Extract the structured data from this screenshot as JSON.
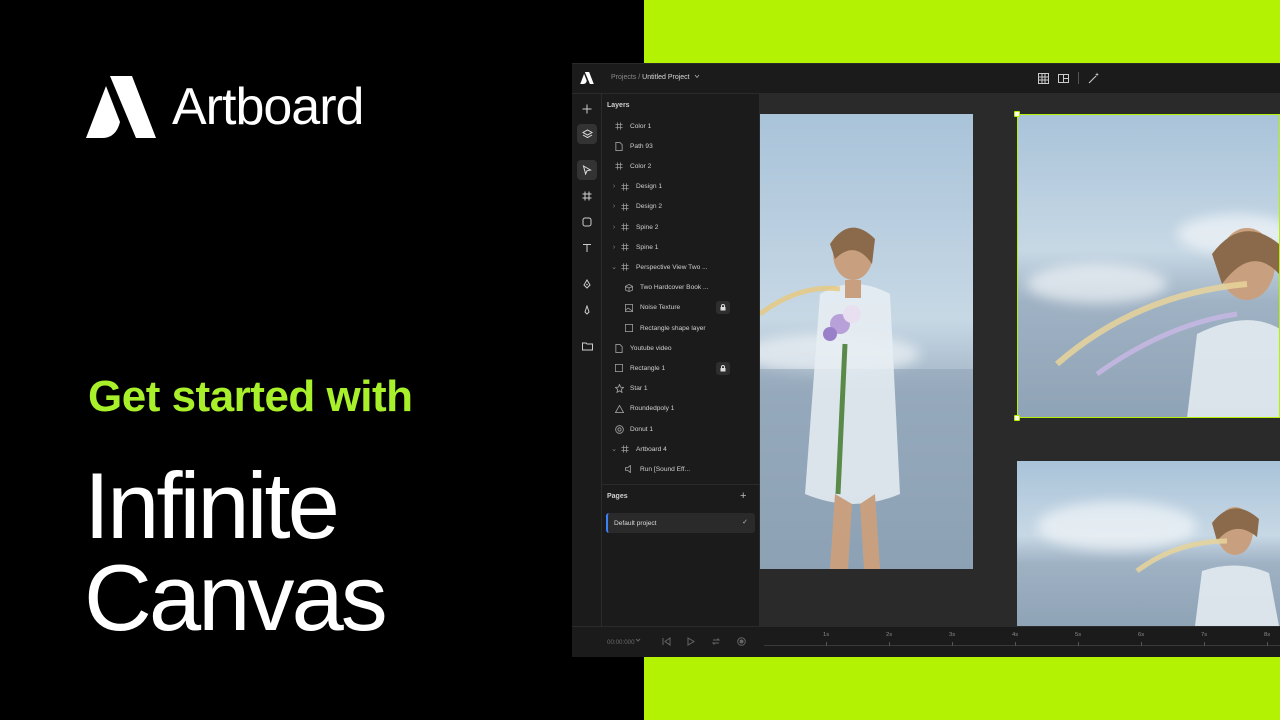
{
  "brand": {
    "name": "Artboard"
  },
  "promo": {
    "subtitle": "Get started with",
    "title_line1": "Infinite",
    "title_line2": "Canvas"
  },
  "colors": {
    "accent": "#b2f202",
    "subtitle": "#a8f02a",
    "app_bg": "#1b1b1b",
    "canvas_bg": "#2a2a2a",
    "page_indicator": "#3b82f6"
  },
  "app": {
    "breadcrumb": {
      "root": "Projects",
      "separator": " / ",
      "current": "Untitled Project"
    },
    "toolbar_icons": [
      "grid-icon",
      "layout-icon",
      "magic-wand-icon"
    ],
    "tools": [
      "add-icon",
      "layers-icon",
      "pointer-icon",
      "frame-icon",
      "shape-icon",
      "text-icon",
      "pen-icon",
      "brush-icon",
      "folder-icon"
    ],
    "layers": {
      "title": "Layers",
      "items": [
        {
          "label": "Color 1",
          "icon": "frame-icon"
        },
        {
          "label": "Path 93",
          "icon": "file-icon"
        },
        {
          "label": "Color 2",
          "icon": "frame-icon"
        },
        {
          "label": "Design 1",
          "icon": "frame-icon",
          "chevron": "right"
        },
        {
          "label": "Design 2",
          "icon": "frame-icon",
          "chevron": "right"
        },
        {
          "label": "Spine 2",
          "icon": "frame-icon",
          "chevron": "right"
        },
        {
          "label": "Spine 1",
          "icon": "frame-icon",
          "chevron": "right"
        },
        {
          "label": "Perspective View Two ...",
          "icon": "frame-icon",
          "chevron": "down"
        },
        {
          "label": "Two Hardcover Book ...",
          "icon": "cube-icon",
          "indent": true
        },
        {
          "label": "Noise Texture",
          "icon": "image-icon",
          "indent": true,
          "locked": true
        },
        {
          "label": "Rectangle shape layer",
          "icon": "rect-icon",
          "indent": true
        },
        {
          "label": "Youtube video",
          "icon": "file-icon"
        },
        {
          "label": "Rectangle 1",
          "icon": "rect-icon",
          "locked": true
        },
        {
          "label": "Star 1",
          "icon": "star-icon"
        },
        {
          "label": "Roundedpoly 1",
          "icon": "triangle-icon"
        },
        {
          "label": "Donut 1",
          "icon": "donut-icon"
        },
        {
          "label": "Artboard 4",
          "icon": "frame-icon",
          "chevron": "down"
        },
        {
          "label": "Run [Sound Eff...",
          "icon": "audio-icon",
          "indent": true
        }
      ]
    },
    "pages": {
      "title": "Pages",
      "add_label": "+",
      "items": [
        {
          "label": "Default project",
          "selected": true
        }
      ]
    },
    "timeline": {
      "time": "00:00:000",
      "ticks": [
        "1s",
        "2s",
        "3s",
        "4s",
        "5s",
        "6s",
        "7s",
        "8s"
      ]
    }
  }
}
